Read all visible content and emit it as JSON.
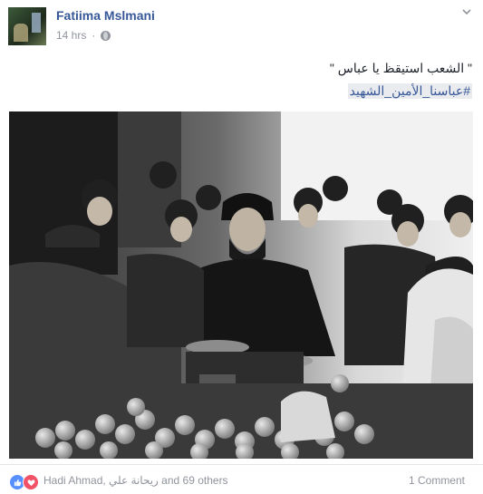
{
  "post": {
    "author": "Fatiima Mslmani",
    "time": "14 hrs",
    "dot": "·",
    "text": "\" الشعب استيقظ يا عباس \"",
    "hashtag": "#عباسنا_الأمين_الشهيد"
  },
  "footer": {
    "reactor1": "Hadi Ahmad",
    "reactor2": "ريحانة علي",
    "others": "and 69 others",
    "comments": "1 Comment"
  },
  "icons": {
    "privacy": "globe-icon",
    "like": "like-icon",
    "love": "love-icon",
    "menu": "chevron-down-icon"
  },
  "colors": {
    "link": "#365899",
    "meta": "#90949c",
    "like": "#5890ff",
    "love": "#f25268"
  }
}
